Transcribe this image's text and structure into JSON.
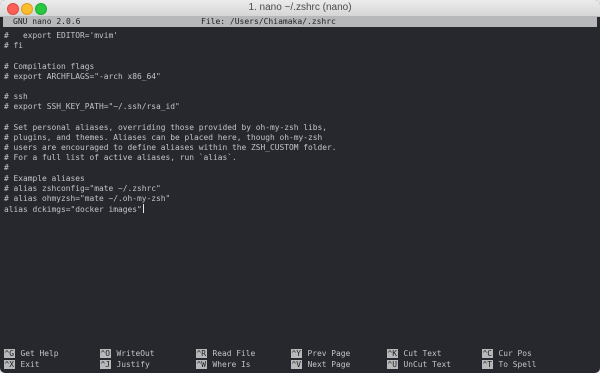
{
  "window": {
    "title": "1. nano ~/.zshrc (nano)"
  },
  "status": {
    "left": "GNU nano 2.0.6",
    "center": "File: /Users/Chiamaka/.zshrc"
  },
  "editor": {
    "lines": [
      "#   export EDITOR='mvim'",
      "# fi",
      "",
      "# Compilation flags",
      "# export ARCHFLAGS=\"-arch x86_64\"",
      "",
      "# ssh",
      "# export SSH_KEY_PATH=\"~/.ssh/rsa_id\"",
      "",
      "# Set personal aliases, overriding those provided by oh-my-zsh libs,",
      "# plugins, and themes. Aliases can be placed here, though oh-my-zsh",
      "# users are encouraged to define aliases within the ZSH_CUSTOM folder.",
      "# For a full list of active aliases, run `alias`.",
      "#",
      "# Example aliases",
      "# alias zshconfig=\"mate ~/.zshrc\"",
      "# alias ohmyzsh=\"mate ~/.oh-my-zsh\"",
      "alias dckimgs=\"docker images\""
    ]
  },
  "shortcuts": [
    {
      "key": "^G",
      "label": "Get Help"
    },
    {
      "key": "^O",
      "label": "WriteOut"
    },
    {
      "key": "^R",
      "label": "Read File"
    },
    {
      "key": "^Y",
      "label": "Prev Page"
    },
    {
      "key": "^K",
      "label": "Cut Text"
    },
    {
      "key": "^C",
      "label": "Cur Pos"
    },
    {
      "key": "^X",
      "label": "Exit"
    },
    {
      "key": "^J",
      "label": "Justify"
    },
    {
      "key": "^W",
      "label": "Where Is"
    },
    {
      "key": "^V",
      "label": "Next Page"
    },
    {
      "key": "^U",
      "label": "UnCut Text"
    },
    {
      "key": "^T",
      "label": "To Spell"
    }
  ]
}
